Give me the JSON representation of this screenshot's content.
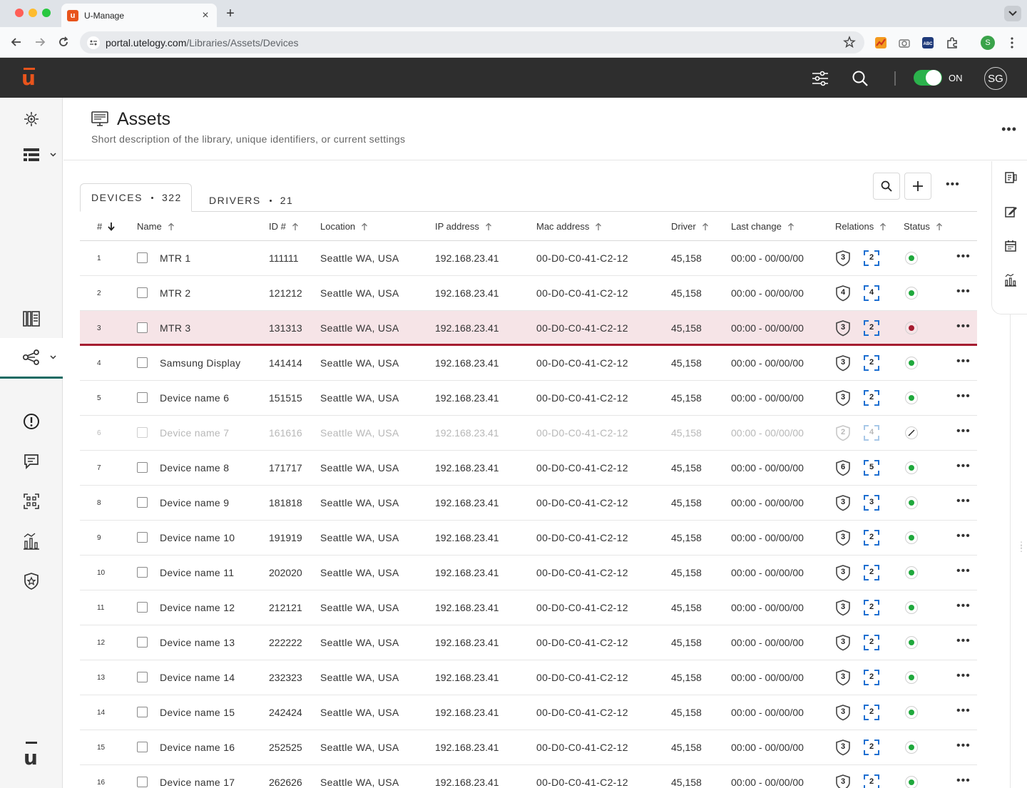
{
  "browser": {
    "tab_title": "U-Manage",
    "tab_favicon": "u",
    "url_host": "portal.utelogy.com",
    "url_path": "/Libraries/Assets/Devices",
    "profile_initial": "S"
  },
  "header": {
    "logo": "u",
    "toggle_label": "ON",
    "avatar_initials": "SG"
  },
  "page": {
    "title": "Assets",
    "description": "Short description of the library, unique identifiers, or current settings"
  },
  "tabs": [
    {
      "label": "DEVICES",
      "count": "322"
    },
    {
      "label": "DRIVERS",
      "count": "21"
    }
  ],
  "table": {
    "headers": {
      "num": "#",
      "name": "Name",
      "id": "ID #",
      "location": "Location",
      "ip": "IP address",
      "mac": "Mac address",
      "driver": "Driver",
      "last_change": "Last change",
      "relations": "Relations",
      "status": "Status"
    },
    "rows": [
      {
        "num": "1",
        "name": "MTR 1",
        "id": "111111",
        "location": "Seattle WA, USA",
        "ip": "192.168.23.41",
        "mac": "00-D0-C0-41-C2-12",
        "driver": "45,158",
        "last_change": "00:00 - 00/00/00",
        "rel_a": "3",
        "rel_b": "2",
        "status": "ok"
      },
      {
        "num": "2",
        "name": "MTR 2",
        "id": "121212",
        "location": "Seattle WA, USA",
        "ip": "192.168.23.41",
        "mac": "00-D0-C0-41-C2-12",
        "driver": "45,158",
        "last_change": "00:00 - 00/00/00",
        "rel_a": "4",
        "rel_b": "4",
        "status": "ok"
      },
      {
        "num": "3",
        "name": "MTR 3",
        "id": "131313",
        "location": "Seattle WA, USA",
        "ip": "192.168.23.41",
        "mac": "00-D0-C0-41-C2-12",
        "driver": "45,158",
        "last_change": "00:00 - 00/00/00",
        "rel_a": "3",
        "rel_b": "2",
        "status": "error"
      },
      {
        "num": "4",
        "name": "Samsung Display",
        "id": "141414",
        "location": "Seattle WA, USA",
        "ip": "192.168.23.41",
        "mac": "00-D0-C0-41-C2-12",
        "driver": "45,158",
        "last_change": "00:00 - 00/00/00",
        "rel_a": "3",
        "rel_b": "2",
        "status": "ok"
      },
      {
        "num": "5",
        "name": "Device name 6",
        "id": "151515",
        "location": "Seattle WA, USA",
        "ip": "192.168.23.41",
        "mac": "00-D0-C0-41-C2-12",
        "driver": "45,158",
        "last_change": "00:00 - 00/00/00",
        "rel_a": "3",
        "rel_b": "2",
        "status": "ok"
      },
      {
        "num": "6",
        "name": "Device name 7",
        "id": "161616",
        "location": "Seattle WA, USA",
        "ip": "192.168.23.41",
        "mac": "00-D0-C0-41-C2-12",
        "driver": "45,158",
        "last_change": "00:00 - 00/00/00",
        "rel_a": "2",
        "rel_b": "4",
        "status": "disabled"
      },
      {
        "num": "7",
        "name": "Device name 8",
        "id": "171717",
        "location": "Seattle WA, USA",
        "ip": "192.168.23.41",
        "mac": "00-D0-C0-41-C2-12",
        "driver": "45,158",
        "last_change": "00:00 - 00/00/00",
        "rel_a": "6",
        "rel_b": "5",
        "status": "ok"
      },
      {
        "num": "8",
        "name": "Device name 9",
        "id": "181818",
        "location": "Seattle WA, USA",
        "ip": "192.168.23.41",
        "mac": "00-D0-C0-41-C2-12",
        "driver": "45,158",
        "last_change": "00:00 - 00/00/00",
        "rel_a": "3",
        "rel_b": "3",
        "status": "ok"
      },
      {
        "num": "9",
        "name": "Device name 10",
        "id": "191919",
        "location": "Seattle WA, USA",
        "ip": "192.168.23.41",
        "mac": "00-D0-C0-41-C2-12",
        "driver": "45,158",
        "last_change": "00:00 - 00/00/00",
        "rel_a": "3",
        "rel_b": "2",
        "status": "ok"
      },
      {
        "num": "10",
        "name": "Device name 11",
        "id": "202020",
        "location": "Seattle WA, USA",
        "ip": "192.168.23.41",
        "mac": "00-D0-C0-41-C2-12",
        "driver": "45,158",
        "last_change": "00:00 - 00/00/00",
        "rel_a": "3",
        "rel_b": "2",
        "status": "ok"
      },
      {
        "num": "11",
        "name": "Device name 12",
        "id": "212121",
        "location": "Seattle WA, USA",
        "ip": "192.168.23.41",
        "mac": "00-D0-C0-41-C2-12",
        "driver": "45,158",
        "last_change": "00:00 - 00/00/00",
        "rel_a": "3",
        "rel_b": "2",
        "status": "ok"
      },
      {
        "num": "12",
        "name": "Device name 13",
        "id": "222222",
        "location": "Seattle WA, USA",
        "ip": "192.168.23.41",
        "mac": "00-D0-C0-41-C2-12",
        "driver": "45,158",
        "last_change": "00:00 - 00/00/00",
        "rel_a": "3",
        "rel_b": "2",
        "status": "ok"
      },
      {
        "num": "13",
        "name": "Device name 14",
        "id": "232323",
        "location": "Seattle WA, USA",
        "ip": "192.168.23.41",
        "mac": "00-D0-C0-41-C2-12",
        "driver": "45,158",
        "last_change": "00:00 - 00/00/00",
        "rel_a": "3",
        "rel_b": "2",
        "status": "ok"
      },
      {
        "num": "14",
        "name": "Device name 15",
        "id": "242424",
        "location": "Seattle WA, USA",
        "ip": "192.168.23.41",
        "mac": "00-D0-C0-41-C2-12",
        "driver": "45,158",
        "last_change": "00:00 - 00/00/00",
        "rel_a": "3",
        "rel_b": "2",
        "status": "ok"
      },
      {
        "num": "15",
        "name": "Device name 16",
        "id": "252525",
        "location": "Seattle WA, USA",
        "ip": "192.168.23.41",
        "mac": "00-D0-C0-41-C2-12",
        "driver": "45,158",
        "last_change": "00:00 - 00/00/00",
        "rel_a": "3",
        "rel_b": "2",
        "status": "ok"
      },
      {
        "num": "16",
        "name": "Device name 17",
        "id": "262626",
        "location": "Seattle WA, USA",
        "ip": "192.168.23.41",
        "mac": "00-D0-C0-41-C2-12",
        "driver": "45,158",
        "last_change": "00:00 - 00/00/00",
        "rel_a": "3",
        "rel_b": "2",
        "status": "ok"
      }
    ]
  },
  "icons": {
    "tool_search": "search-icon",
    "tool_add": "plus-icon",
    "row_more": "more-horizontal-icon"
  },
  "colors": {
    "accent": "#e8541c",
    "status_ok": "#1fa83c",
    "status_error": "#a51c30",
    "active_nav": "#1a6b63",
    "highlight_row": "#f6e4e7"
  }
}
